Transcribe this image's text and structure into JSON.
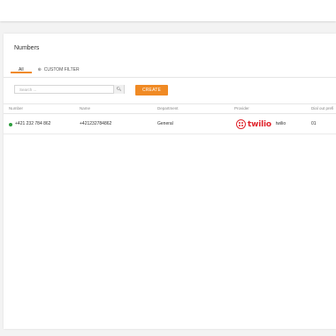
{
  "panel": {
    "title": "Numbers"
  },
  "tabs": [
    {
      "label": "All",
      "active": true
    },
    {
      "label": "CUSTOM FILTER",
      "icon": "filter-icon",
      "active": false
    }
  ],
  "search": {
    "placeholder": "Search ...",
    "icon": "search-icon"
  },
  "create_button": {
    "label": "CREATE"
  },
  "table": {
    "columns": [
      "Number",
      "Name",
      "Department",
      "Provider",
      "Dial out prefi"
    ],
    "rows": [
      {
        "number": "+421 232 784 862",
        "name": "+421232784862",
        "department": "General",
        "provider_logo_text": "twilio",
        "provider": "twilio",
        "dial_out_prefix": "01",
        "status_color": "#2e9e3e"
      }
    ]
  },
  "colors": {
    "accent": "#f08a24",
    "twilio_red": "#e0262e"
  }
}
